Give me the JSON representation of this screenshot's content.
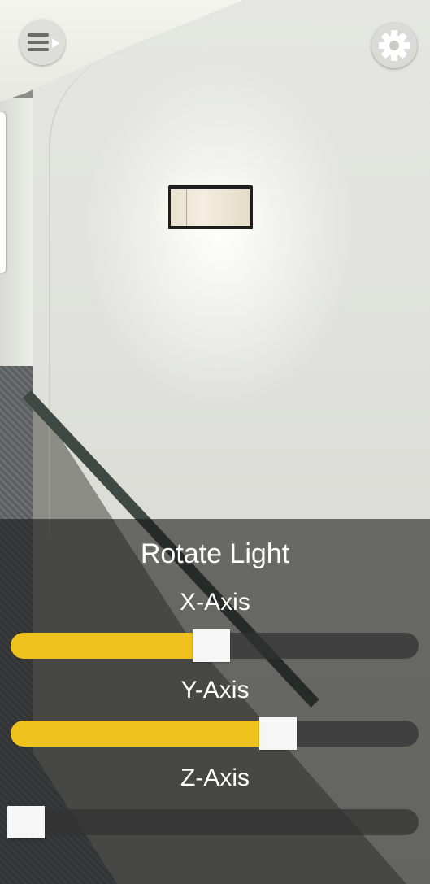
{
  "header": {
    "menu_button_icon": "hamburger-menu-icon",
    "settings_button_icon": "gear-icon"
  },
  "panel": {
    "title": "Rotate Light",
    "accent_color": "#f0c21d",
    "sliders": [
      {
        "label": "X-Axis",
        "value_fraction": 0.5
      },
      {
        "label": "Y-Axis",
        "value_fraction": 0.68
      },
      {
        "label": "Z-Axis",
        "value_fraction": 0.0
      }
    ]
  }
}
